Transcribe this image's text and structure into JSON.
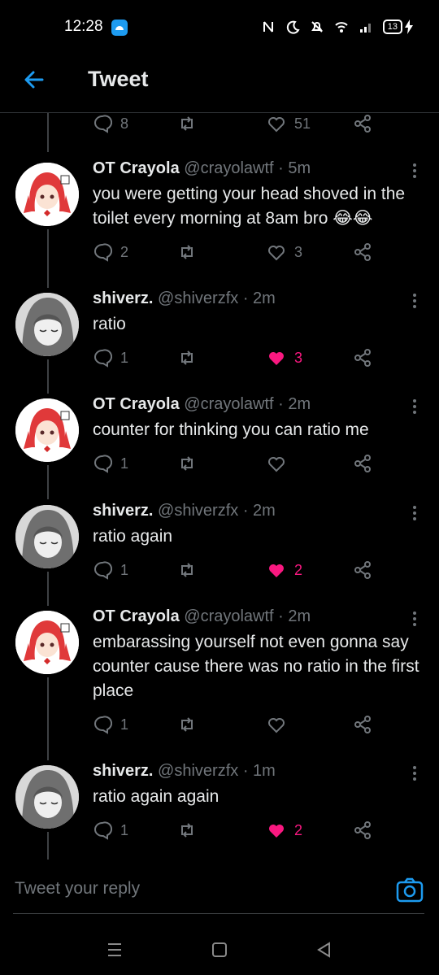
{
  "status_bar": {
    "time": "12:28",
    "battery": "13"
  },
  "header": {
    "title": "Tweet"
  },
  "top_actions": {
    "reply_count": "8",
    "retweet_count": "",
    "like_count": "51"
  },
  "tweets": [
    {
      "name": "OT Crayola",
      "handle": "@crayolawtf",
      "time": "· 5m",
      "text": "you were getting your head shoved in the toilet every morning at 8am bro 😂😂",
      "reply_count": "2",
      "retweet_count": "",
      "like_count": "3",
      "liked": false
    },
    {
      "name": "shiverz.",
      "handle": "@shiverzfx",
      "time": "· 2m",
      "text": "ratio",
      "reply_count": "1",
      "retweet_count": "",
      "like_count": "3",
      "liked": true
    },
    {
      "name": "OT Crayola",
      "handle": "@crayolawtf",
      "time": "· 2m",
      "text": "counter for thinking you can ratio me",
      "reply_count": "1",
      "retweet_count": "",
      "like_count": "",
      "liked": false
    },
    {
      "name": "shiverz.",
      "handle": "@shiverzfx",
      "time": "· 2m",
      "text": "ratio again",
      "reply_count": "1",
      "retweet_count": "",
      "like_count": "2",
      "liked": true
    },
    {
      "name": "OT Crayola",
      "handle": "@crayolawtf",
      "time": "· 2m",
      "text": "embarassing yourself not even gonna say counter cause there was no ratio in the first place",
      "reply_count": "1",
      "retweet_count": "",
      "like_count": "",
      "liked": false
    },
    {
      "name": "shiverz.",
      "handle": "@shiverzfx",
      "time": "· 1m",
      "text": "ratio again again",
      "reply_count": "1",
      "retweet_count": "",
      "like_count": "2",
      "liked": true
    }
  ],
  "reply": {
    "placeholder": "Tweet your reply"
  },
  "icons": {
    "back": "arrow-left-icon",
    "reply": "speech-bubble-icon",
    "retweet": "retweet-icon",
    "like": "heart-icon",
    "share": "share-icon",
    "more": "vertical-dots-icon",
    "camera": "camera-icon"
  },
  "colors": {
    "accent": "#1d9bf0",
    "like": "#f91880",
    "muted": "#71767b",
    "background": "#000000"
  }
}
